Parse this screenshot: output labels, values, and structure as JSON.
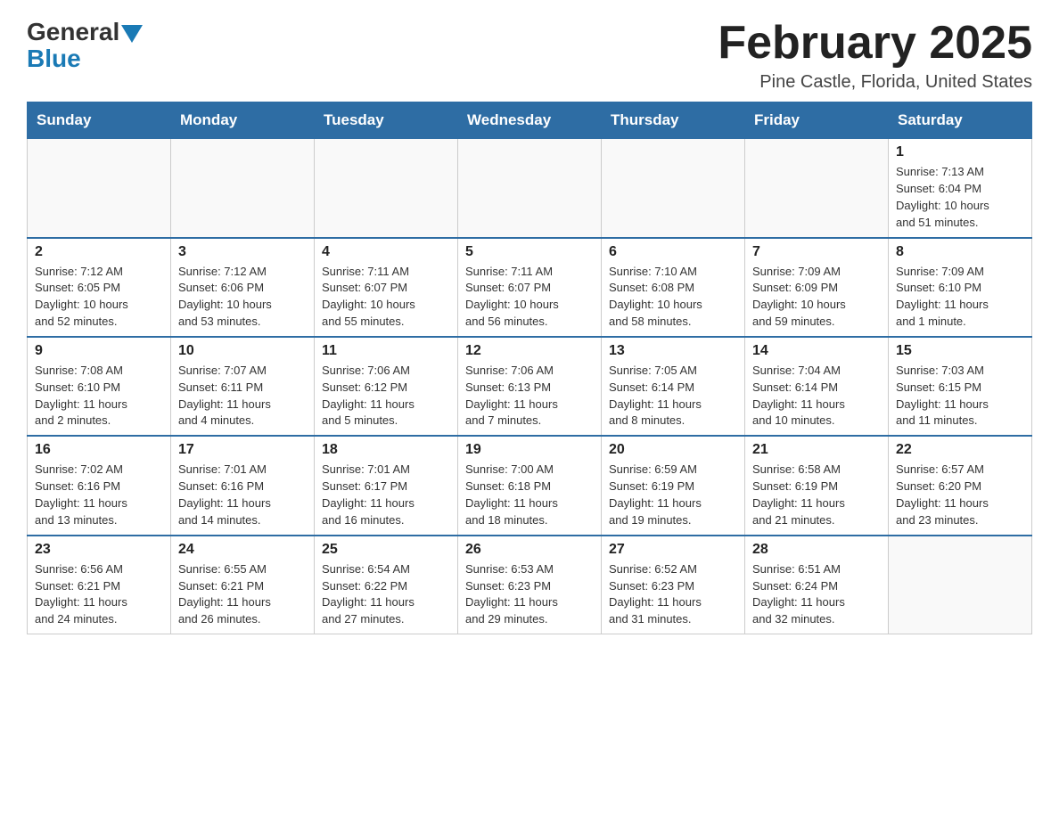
{
  "header": {
    "logo_general": "General",
    "logo_blue": "Blue",
    "title": "February 2025",
    "location": "Pine Castle, Florida, United States"
  },
  "days_of_week": [
    "Sunday",
    "Monday",
    "Tuesday",
    "Wednesday",
    "Thursday",
    "Friday",
    "Saturday"
  ],
  "weeks": [
    [
      {
        "day": "",
        "info": ""
      },
      {
        "day": "",
        "info": ""
      },
      {
        "day": "",
        "info": ""
      },
      {
        "day": "",
        "info": ""
      },
      {
        "day": "",
        "info": ""
      },
      {
        "day": "",
        "info": ""
      },
      {
        "day": "1",
        "info": "Sunrise: 7:13 AM\nSunset: 6:04 PM\nDaylight: 10 hours\nand 51 minutes."
      }
    ],
    [
      {
        "day": "2",
        "info": "Sunrise: 7:12 AM\nSunset: 6:05 PM\nDaylight: 10 hours\nand 52 minutes."
      },
      {
        "day": "3",
        "info": "Sunrise: 7:12 AM\nSunset: 6:06 PM\nDaylight: 10 hours\nand 53 minutes."
      },
      {
        "day": "4",
        "info": "Sunrise: 7:11 AM\nSunset: 6:07 PM\nDaylight: 10 hours\nand 55 minutes."
      },
      {
        "day": "5",
        "info": "Sunrise: 7:11 AM\nSunset: 6:07 PM\nDaylight: 10 hours\nand 56 minutes."
      },
      {
        "day": "6",
        "info": "Sunrise: 7:10 AM\nSunset: 6:08 PM\nDaylight: 10 hours\nand 58 minutes."
      },
      {
        "day": "7",
        "info": "Sunrise: 7:09 AM\nSunset: 6:09 PM\nDaylight: 10 hours\nand 59 minutes."
      },
      {
        "day": "8",
        "info": "Sunrise: 7:09 AM\nSunset: 6:10 PM\nDaylight: 11 hours\nand 1 minute."
      }
    ],
    [
      {
        "day": "9",
        "info": "Sunrise: 7:08 AM\nSunset: 6:10 PM\nDaylight: 11 hours\nand 2 minutes."
      },
      {
        "day": "10",
        "info": "Sunrise: 7:07 AM\nSunset: 6:11 PM\nDaylight: 11 hours\nand 4 minutes."
      },
      {
        "day": "11",
        "info": "Sunrise: 7:06 AM\nSunset: 6:12 PM\nDaylight: 11 hours\nand 5 minutes."
      },
      {
        "day": "12",
        "info": "Sunrise: 7:06 AM\nSunset: 6:13 PM\nDaylight: 11 hours\nand 7 minutes."
      },
      {
        "day": "13",
        "info": "Sunrise: 7:05 AM\nSunset: 6:14 PM\nDaylight: 11 hours\nand 8 minutes."
      },
      {
        "day": "14",
        "info": "Sunrise: 7:04 AM\nSunset: 6:14 PM\nDaylight: 11 hours\nand 10 minutes."
      },
      {
        "day": "15",
        "info": "Sunrise: 7:03 AM\nSunset: 6:15 PM\nDaylight: 11 hours\nand 11 minutes."
      }
    ],
    [
      {
        "day": "16",
        "info": "Sunrise: 7:02 AM\nSunset: 6:16 PM\nDaylight: 11 hours\nand 13 minutes."
      },
      {
        "day": "17",
        "info": "Sunrise: 7:01 AM\nSunset: 6:16 PM\nDaylight: 11 hours\nand 14 minutes."
      },
      {
        "day": "18",
        "info": "Sunrise: 7:01 AM\nSunset: 6:17 PM\nDaylight: 11 hours\nand 16 minutes."
      },
      {
        "day": "19",
        "info": "Sunrise: 7:00 AM\nSunset: 6:18 PM\nDaylight: 11 hours\nand 18 minutes."
      },
      {
        "day": "20",
        "info": "Sunrise: 6:59 AM\nSunset: 6:19 PM\nDaylight: 11 hours\nand 19 minutes."
      },
      {
        "day": "21",
        "info": "Sunrise: 6:58 AM\nSunset: 6:19 PM\nDaylight: 11 hours\nand 21 minutes."
      },
      {
        "day": "22",
        "info": "Sunrise: 6:57 AM\nSunset: 6:20 PM\nDaylight: 11 hours\nand 23 minutes."
      }
    ],
    [
      {
        "day": "23",
        "info": "Sunrise: 6:56 AM\nSunset: 6:21 PM\nDaylight: 11 hours\nand 24 minutes."
      },
      {
        "day": "24",
        "info": "Sunrise: 6:55 AM\nSunset: 6:21 PM\nDaylight: 11 hours\nand 26 minutes."
      },
      {
        "day": "25",
        "info": "Sunrise: 6:54 AM\nSunset: 6:22 PM\nDaylight: 11 hours\nand 27 minutes."
      },
      {
        "day": "26",
        "info": "Sunrise: 6:53 AM\nSunset: 6:23 PM\nDaylight: 11 hours\nand 29 minutes."
      },
      {
        "day": "27",
        "info": "Sunrise: 6:52 AM\nSunset: 6:23 PM\nDaylight: 11 hours\nand 31 minutes."
      },
      {
        "day": "28",
        "info": "Sunrise: 6:51 AM\nSunset: 6:24 PM\nDaylight: 11 hours\nand 32 minutes."
      },
      {
        "day": "",
        "info": ""
      }
    ]
  ]
}
